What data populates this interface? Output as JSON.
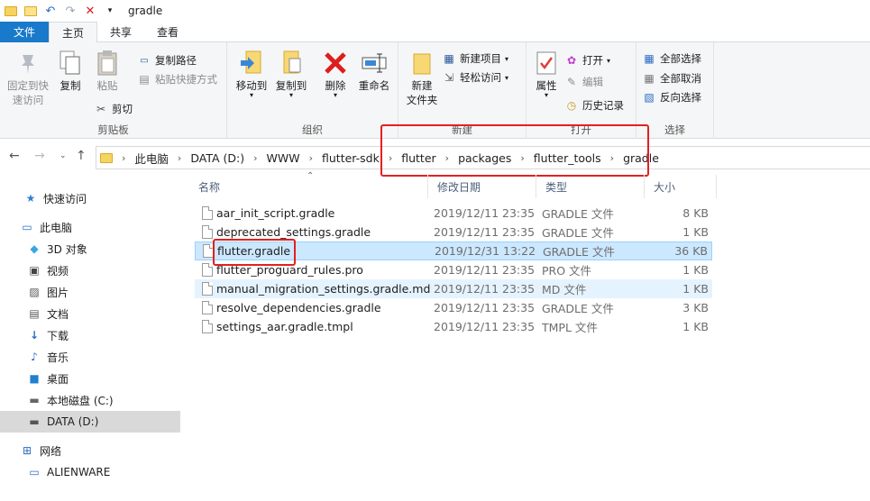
{
  "window": {
    "title": "gradle"
  },
  "tabs": [
    {
      "label": "文件"
    },
    {
      "label": "主页"
    },
    {
      "label": "共享"
    },
    {
      "label": "查看"
    }
  ],
  "ribbon": {
    "clipboard": {
      "label": "剪贴板",
      "pin": "固定到快\n速访问",
      "copy": "复制",
      "paste": "粘贴",
      "copy_path": "复制路径",
      "paste_shortcut": "粘贴快捷方式",
      "cut": "剪切"
    },
    "organize": {
      "label": "组织",
      "move_to": "移动到",
      "copy_to": "复制到",
      "delete": "删除",
      "rename": "重命名"
    },
    "new": {
      "label": "新建",
      "new_folder": "新建\n文件夹",
      "new_item": "新建项目",
      "easy_access": "轻松访问"
    },
    "open": {
      "label": "打开",
      "properties": "属性",
      "open": "打开",
      "edit": "编辑",
      "history": "历史记录"
    },
    "select": {
      "label": "选择",
      "select_all": "全部选择",
      "select_none": "全部取消",
      "invert": "反向选择"
    }
  },
  "address": {
    "crumbs": [
      "此电脑",
      "DATA (D:)",
      "WWW",
      "flutter-sdk",
      "flutter",
      "packages",
      "flutter_tools",
      "gradle"
    ]
  },
  "sidebar": {
    "items": [
      {
        "label": "快速访问",
        "icon": "star-icon"
      },
      {
        "label": "此电脑",
        "icon": "computer-icon"
      },
      {
        "label": "3D 对象",
        "icon": "cube-icon"
      },
      {
        "label": "视频",
        "icon": "video-icon"
      },
      {
        "label": "图片",
        "icon": "picture-icon"
      },
      {
        "label": "文档",
        "icon": "document-icon"
      },
      {
        "label": "下载",
        "icon": "download-icon"
      },
      {
        "label": "音乐",
        "icon": "music-icon"
      },
      {
        "label": "桌面",
        "icon": "desktop-icon"
      },
      {
        "label": "本地磁盘 (C:)",
        "icon": "drive-icon"
      },
      {
        "label": "DATA (D:)",
        "icon": "drive-icon"
      },
      {
        "label": "网络",
        "icon": "network-icon"
      },
      {
        "label": "ALIENWARE",
        "icon": "computer-icon"
      }
    ]
  },
  "columns": {
    "name": "名称",
    "modified": "修改日期",
    "type": "类型",
    "size": "大小"
  },
  "files": [
    {
      "name": "aar_init_script.gradle",
      "modified": "2019/12/11 23:35",
      "type": "GRADLE 文件",
      "size": "8 KB"
    },
    {
      "name": "deprecated_settings.gradle",
      "modified": "2019/12/11 23:35",
      "type": "GRADLE 文件",
      "size": "1 KB"
    },
    {
      "name": "flutter.gradle",
      "modified": "2019/12/31 13:22",
      "type": "GRADLE 文件",
      "size": "36 KB"
    },
    {
      "name": "flutter_proguard_rules.pro",
      "modified": "2019/12/11 23:35",
      "type": "PRO 文件",
      "size": "1 KB"
    },
    {
      "name": "manual_migration_settings.gradle.md",
      "modified": "2019/12/11 23:35",
      "type": "MD 文件",
      "size": "1 KB"
    },
    {
      "name": "resolve_dependencies.gradle",
      "modified": "2019/12/11 23:35",
      "type": "GRADLE 文件",
      "size": "3 KB"
    },
    {
      "name": "settings_aar.gradle.tmpl",
      "modified": "2019/12/11 23:35",
      "type": "TMPL 文件",
      "size": "1 KB"
    }
  ]
}
